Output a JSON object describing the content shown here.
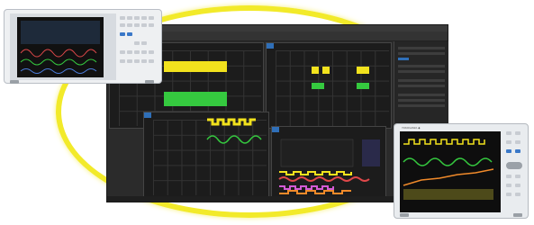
{
  "scene": {
    "accent_ring_color": "#f2ea2a"
  },
  "software_window": {
    "title": "",
    "panels": [
      {
        "tab": "",
        "traces": [
          "yellow",
          "green"
        ]
      },
      {
        "tab": "",
        "traces": [
          "yellow",
          "green"
        ]
      },
      {
        "tab": "",
        "traces": [
          "yellow",
          "green"
        ]
      },
      {
        "tab": "",
        "traces": [
          "yellow",
          "red",
          "magenta",
          "orange"
        ]
      }
    ]
  },
  "device_left": {
    "brand": "YOKOGAWA ◆",
    "screen_traces": [
      "red",
      "green",
      "blue"
    ]
  },
  "device_right": {
    "brand": "YOKOGAWA ◆",
    "screen_traces": [
      "yellow",
      "green",
      "orange"
    ]
  },
  "colors": {
    "trace_yellow": "#f2e21d",
    "trace_green": "#35c93f",
    "trace_red": "#e0484a",
    "trace_magenta": "#d45bd6",
    "trace_orange": "#f08a2a",
    "panel_tab": "#2f6fb8"
  }
}
